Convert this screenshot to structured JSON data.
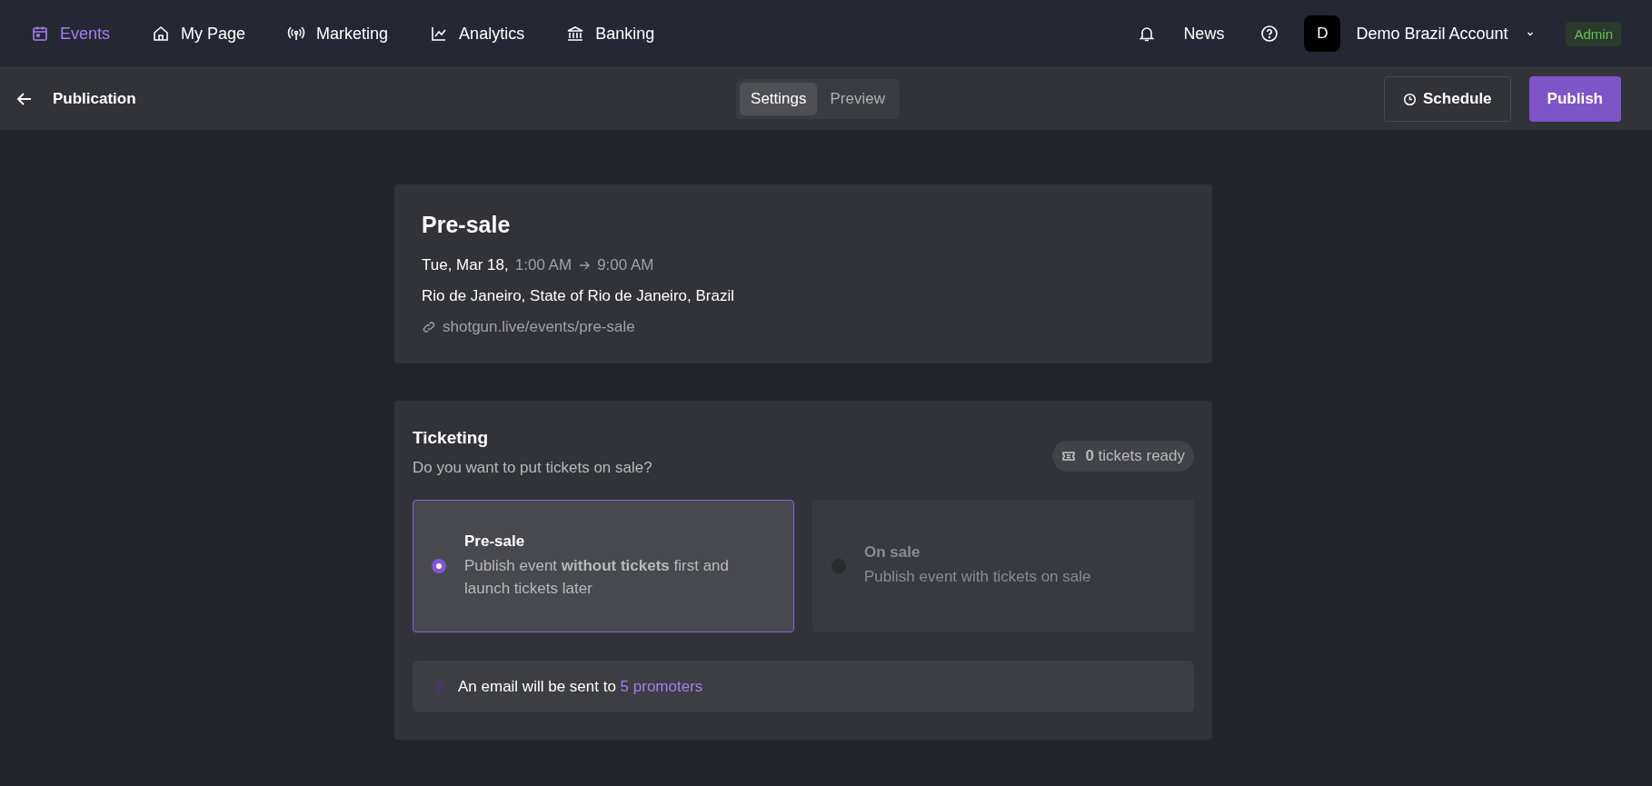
{
  "nav": {
    "items": [
      {
        "label": "Events",
        "selected": true
      },
      {
        "label": "My Page",
        "selected": false
      },
      {
        "label": "Marketing",
        "selected": false
      },
      {
        "label": "Analytics",
        "selected": false
      },
      {
        "label": "Banking",
        "selected": false
      }
    ],
    "news": "News",
    "avatar": "D",
    "account": "Demo Brazil Account",
    "role": "Admin"
  },
  "toolbar": {
    "title": "Publication",
    "tabs": [
      {
        "label": "Settings",
        "selected": true
      },
      {
        "label": "Preview",
        "selected": false
      }
    ],
    "schedule": "Schedule",
    "publish": "Publish"
  },
  "event": {
    "title": "Pre-sale",
    "date": "Tue, Mar 18,",
    "start": "1:00 AM",
    "end": "9:00 AM",
    "location": "Rio de Janeiro, State of Rio de Janeiro, Brazil",
    "url": "shotgun.live/events/pre-sale"
  },
  "ticketing": {
    "title": "Ticketing",
    "question": "Do you want to put tickets on sale?",
    "tickets_ready": "**0** tickets ready",
    "options": [
      {
        "title": "Pre-sale",
        "description": "Publish event **without tickets** first and launch tickets later",
        "selected": true
      },
      {
        "title": "On sale",
        "description": "Publish event with tickets on sale",
        "selected": false
      }
    ],
    "email_notice": "An email will be sent to",
    "email_link": "5 promoters"
  }
}
